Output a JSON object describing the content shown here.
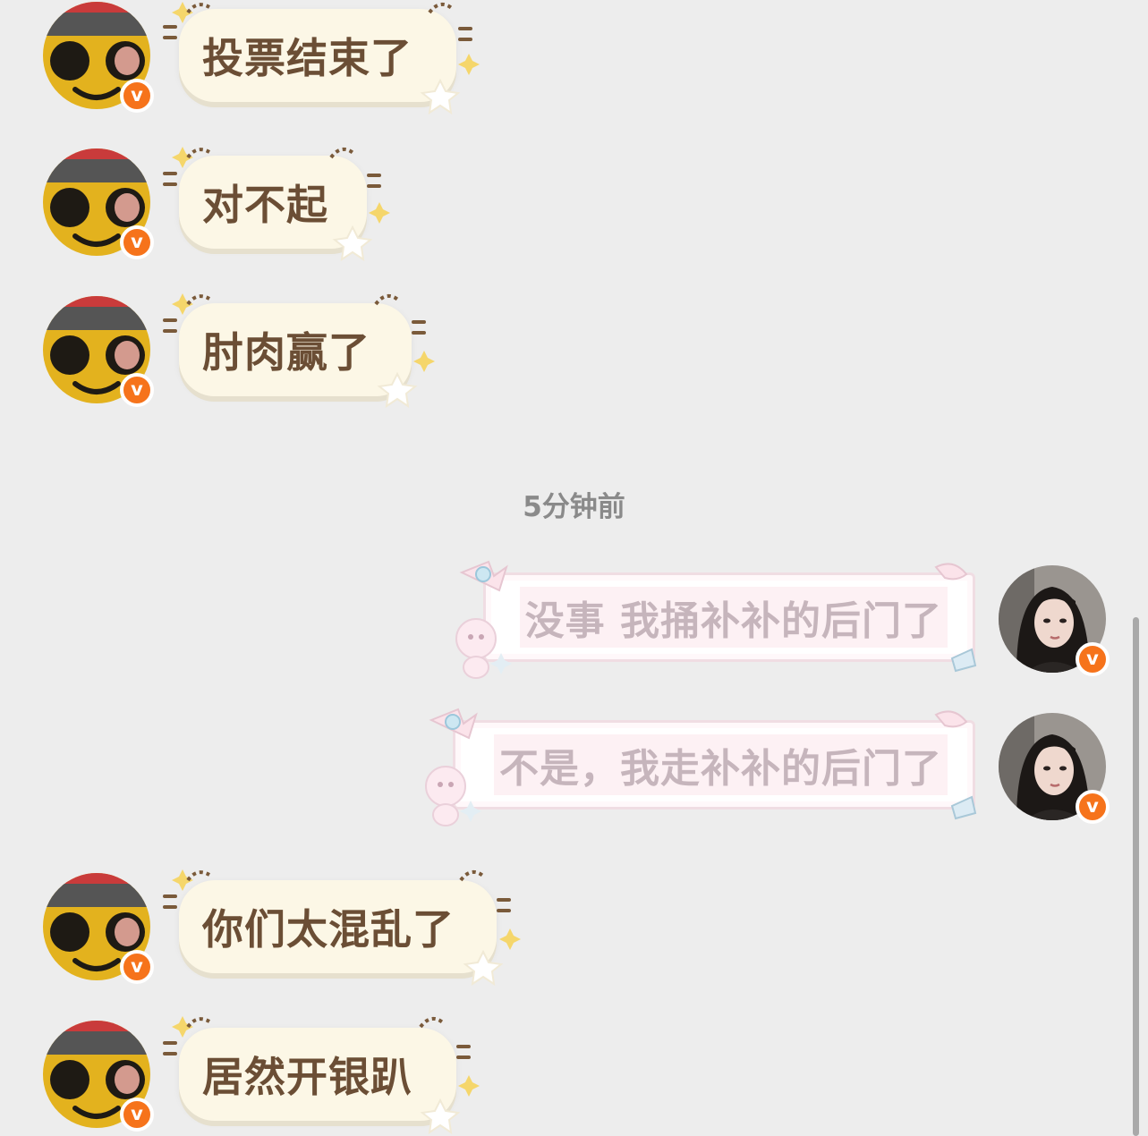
{
  "conversation": {
    "timestamp_divider": "5分钟前",
    "messages": [
      {
        "side": "left",
        "sender": "yellow-smiley",
        "text": "投票结束了"
      },
      {
        "side": "left",
        "sender": "yellow-smiley",
        "text": "对不起"
      },
      {
        "side": "left",
        "sender": "yellow-smiley",
        "text": "肘肉赢了"
      },
      {
        "side": "right",
        "sender": "girl-avatar",
        "text": "没事 我捅补补的后门了"
      },
      {
        "side": "right",
        "sender": "girl-avatar",
        "text": "不是，我走补补的后门了"
      },
      {
        "side": "left",
        "sender": "yellow-smiley",
        "text": "你们太混乱了"
      },
      {
        "side": "left",
        "sender": "yellow-smiley",
        "text": "居然开银趴"
      }
    ]
  },
  "badge": {
    "label": "v",
    "color": "#F6731B"
  },
  "colors": {
    "background": "#EDEDED",
    "left_bubble": "#FCF7E6",
    "left_text": "#6B4E35",
    "right_text": "#C6B5BC"
  },
  "icons": {
    "sender_left_avatar": "yellow-smiley-avatar",
    "sender_right_avatar": "girl-portrait-avatar",
    "verified_badge": "verified-v-badge-icon",
    "bubble_decor_left": "sparkle-star-icon",
    "bubble_decor_right": "ribbon-bow-icon"
  }
}
